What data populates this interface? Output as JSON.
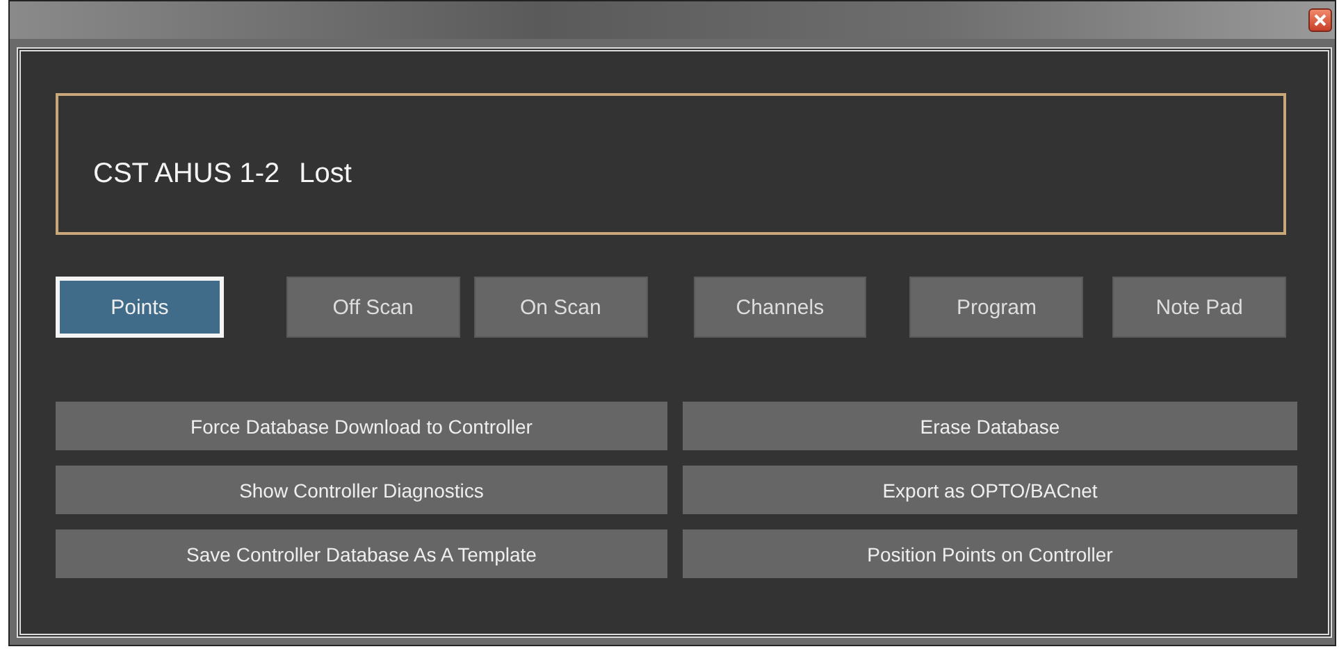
{
  "header": {
    "title": "CST AHUS 1-2",
    "status": "Lost"
  },
  "tabs": [
    {
      "label": "Points",
      "selected": true
    },
    {
      "label": "Off Scan",
      "selected": false
    },
    {
      "label": "On Scan",
      "selected": false
    },
    {
      "label": "Channels",
      "selected": false
    },
    {
      "label": "Program",
      "selected": false
    },
    {
      "label": "Note Pad",
      "selected": false
    }
  ],
  "actions": [
    "Force Database Download to Controller",
    "Erase Database",
    "Show Controller Diagnostics",
    "Export as OPTO/BACnet",
    "Save Controller Database As A Template",
    "Position Points on Controller"
  ]
}
